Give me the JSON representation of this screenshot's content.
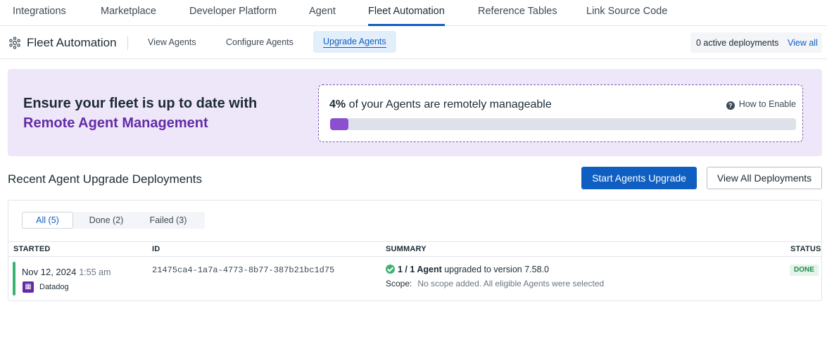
{
  "top_nav": {
    "tabs": [
      {
        "label": "Integrations"
      },
      {
        "label": "Marketplace"
      },
      {
        "label": "Developer Platform"
      },
      {
        "label": "Agent"
      },
      {
        "label": "Fleet Automation"
      },
      {
        "label": "Reference Tables"
      },
      {
        "label": "Link Source Code"
      }
    ],
    "active": "Fleet Automation"
  },
  "sub_header": {
    "icon": "gear-icon",
    "title": "Fleet Automation",
    "tabs": [
      {
        "label": "View Agents"
      },
      {
        "label": "Configure Agents"
      },
      {
        "label": "Upgrade Agents"
      }
    ],
    "active": "Upgrade Agents",
    "active_deployments": "0 active deployments",
    "view_all": "View all"
  },
  "banner": {
    "line1": "Ensure your fleet is up to date with",
    "line2": "Remote Agent Management",
    "percent_label": "4%",
    "percent_text": "of your Agents are remotely manageable",
    "progress_fraction": 0.04,
    "how_to_enable": "How to Enable",
    "accent_color": "#632ca6"
  },
  "section": {
    "title": "Recent Agent Upgrade Deployments",
    "primary_button": "Start Agents Upgrade",
    "secondary_button": "View All Deployments"
  },
  "filters": [
    {
      "label": "All (5)"
    },
    {
      "label": "Done (2)"
    },
    {
      "label": "Failed (3)"
    }
  ],
  "table": {
    "columns": [
      "STARTED",
      "ID",
      "SUMMARY",
      "STATUS"
    ],
    "rows": [
      {
        "date": "Nov 12, 2024",
        "time": "1:55 am",
        "org": "Datadog",
        "id": "21475ca4-1a7a-4773-8b77-387b21bc1d75",
        "summary_bold": "1 / 1 Agent",
        "summary_rest": "upgraded to version 7.58.0",
        "scope_label": "Scope:",
        "scope_value": "No scope added. All eligible Agents were selected",
        "status": "DONE",
        "status_color": "#1f8a4c"
      }
    ]
  }
}
